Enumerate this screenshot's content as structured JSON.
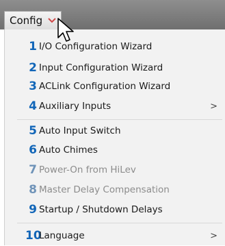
{
  "menubar": {
    "title": "Config"
  },
  "menu": {
    "items": [
      {
        "number": "1",
        "label": "I/O Configuration Wizard",
        "enabled": true,
        "submenu": false
      },
      {
        "number": "2",
        "label": "Input Configuration Wizard",
        "enabled": true,
        "submenu": false
      },
      {
        "number": "3",
        "label": "ACLink Configuration Wizard",
        "enabled": true,
        "submenu": false
      },
      {
        "number": "4",
        "label": "Auxiliary Inputs",
        "enabled": true,
        "submenu": true,
        "arrow": ">"
      },
      {
        "number": "5",
        "label": "Auto Input Switch",
        "enabled": true,
        "submenu": false
      },
      {
        "number": "6",
        "label": "Auto Chimes",
        "enabled": true,
        "submenu": false
      },
      {
        "number": "7",
        "label": "Power-On from HiLev",
        "enabled": false,
        "submenu": false
      },
      {
        "number": "8",
        "label": "Master Delay Compensation",
        "enabled": false,
        "submenu": false
      },
      {
        "number": "9",
        "label": "Startup / Shutdown Delays",
        "enabled": true,
        "submenu": false
      },
      {
        "number": "10",
        "label": "Language",
        "enabled": true,
        "submenu": true,
        "arrow": ">"
      }
    ]
  },
  "colors": {
    "number": "#1266b8",
    "disabled_text": "#8c8c8c",
    "menubar": "#7d7d7d"
  },
  "icons": {
    "caret": "chevron-down-icon",
    "cursor": "mouse-pointer-icon"
  }
}
